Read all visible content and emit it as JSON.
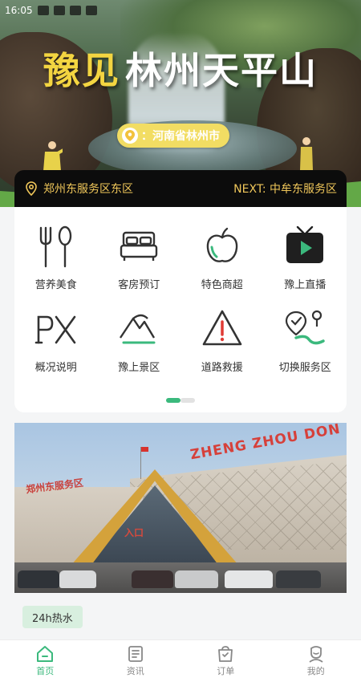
{
  "status_bar": {
    "time": "16:05"
  },
  "hero": {
    "title_part1": "豫见",
    "title_part2": "林州天平山",
    "location": "：河南省林州市"
  },
  "service_bar": {
    "current": "郑州东服务区东区",
    "next": "NEXT:  中牟东服务区"
  },
  "menu": {
    "items": [
      {
        "label": "营养美食",
        "icon": "fork-spoon-icon"
      },
      {
        "label": "客房预订",
        "icon": "bed-icon"
      },
      {
        "label": "特色商超",
        "icon": "apple-icon"
      },
      {
        "label": "豫上直播",
        "icon": "tv-play-icon"
      },
      {
        "label": "概况说明",
        "icon": "px-icon"
      },
      {
        "label": "豫上景区",
        "icon": "mountain-icon"
      },
      {
        "label": "道路救援",
        "icon": "warning-icon"
      },
      {
        "label": "切换服务区",
        "icon": "route-pin-icon"
      }
    ],
    "page": 1,
    "pages": 2
  },
  "photo": {
    "sign_en": "ZHENG ZHOU DON",
    "sign_cn": "郑州东服务区",
    "entry": "入口"
  },
  "tag": "24h热水",
  "tabbar": {
    "items": [
      {
        "label": "首页",
        "icon": "home-icon",
        "active": true
      },
      {
        "label": "资讯",
        "icon": "news-icon",
        "active": false
      },
      {
        "label": "订单",
        "icon": "order-bag-icon",
        "active": false
      },
      {
        "label": "我的",
        "icon": "profile-icon",
        "active": false
      }
    ]
  },
  "colors": {
    "accent_green": "#3bb97d",
    "gold": "#f0c75a",
    "title_yellow": "#f3d541",
    "bar_black": "#0c0c0c"
  }
}
